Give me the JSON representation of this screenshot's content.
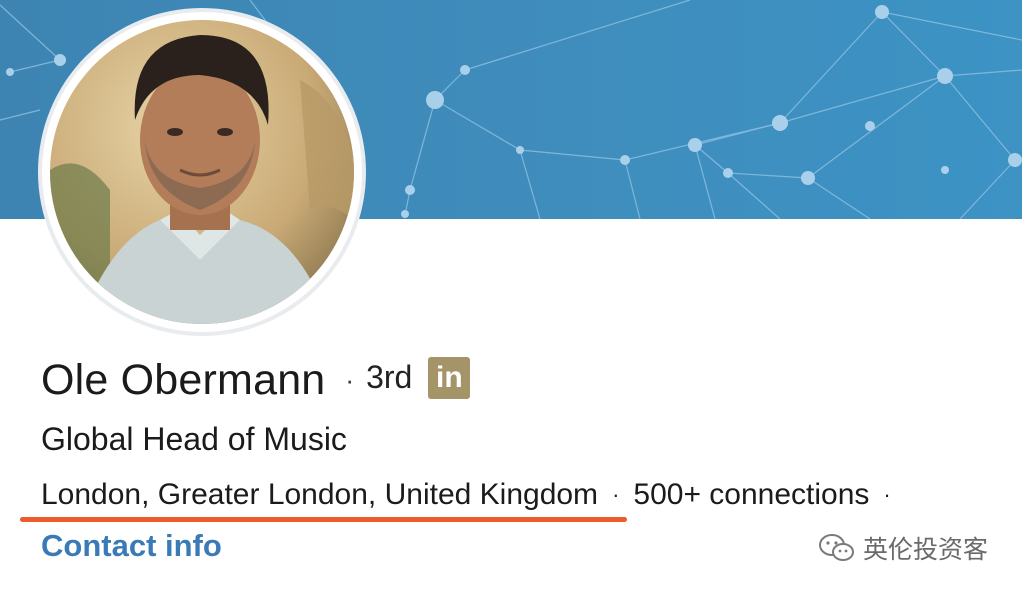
{
  "profile": {
    "name": "Ole Obermann",
    "separator": "·",
    "degree": "3rd",
    "linkedin_badge": "in",
    "headline": "Global Head of Music",
    "location": "London, Greater London, United Kingdom",
    "connections": "500+ connections",
    "contact_link": "Contact info"
  },
  "watermark": {
    "text": "英伦投资客"
  },
  "colors": {
    "banner": "#3f8dbd",
    "link": "#3a7ab7",
    "badge": "#a59467",
    "highlight": "#ef5a2d"
  },
  "icons": {
    "banner": "network-pattern",
    "badge": "linkedin-icon",
    "watermark": "wechat-icon"
  }
}
